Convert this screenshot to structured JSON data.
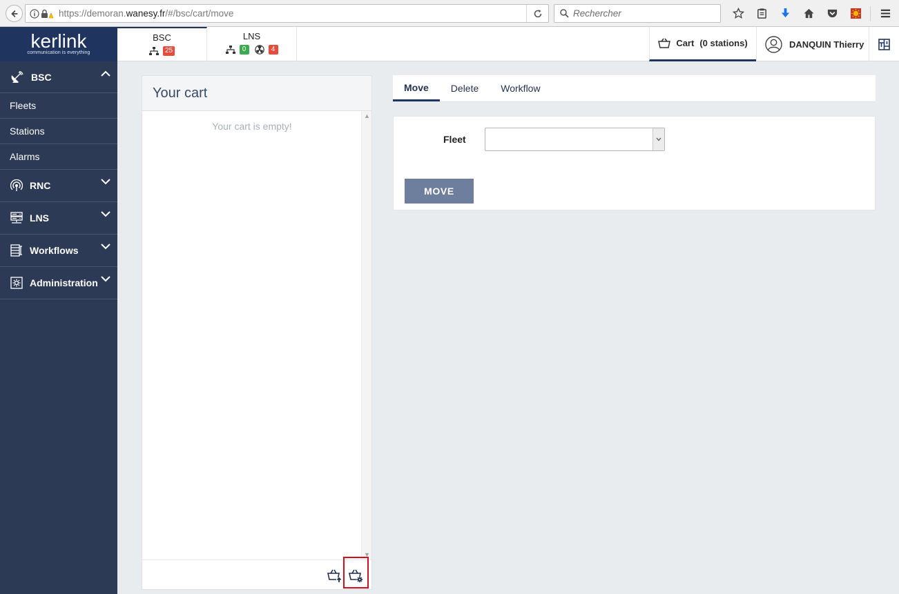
{
  "browser": {
    "url_prefix": "https://demoran.",
    "url_host": "wanesy.fr",
    "url_path": "/#/bsc/cart/move",
    "search_placeholder": "Rechercher"
  },
  "header": {
    "logo_text": "kerlink",
    "logo_tagline": "communication is everything",
    "modules": [
      {
        "title": "BSC",
        "stats": [
          {
            "icon": "network-icon",
            "count": "25",
            "color": "#e74c3c"
          }
        ]
      },
      {
        "title": "LNS",
        "stats": [
          {
            "icon": "network-icon",
            "count": "0",
            "color": "#3cab4f"
          },
          {
            "icon": "radiation-icon",
            "count": "4",
            "color": "#e74c3c"
          }
        ]
      }
    ],
    "cart_label": "Cart",
    "cart_count": "(0 stations)",
    "user_name": "DANQUIN Thierry"
  },
  "sidebar": {
    "groups": [
      {
        "label": "BSC",
        "icon": "satellite-dish-icon",
        "expanded": true,
        "items": [
          "Fleets",
          "Stations",
          "Alarms"
        ]
      },
      {
        "label": "RNC",
        "icon": "antenna-icon",
        "expanded": false
      },
      {
        "label": "LNS",
        "icon": "server-icon",
        "expanded": false
      },
      {
        "label": "Workflows",
        "icon": "workflow-icon",
        "expanded": false
      },
      {
        "label": "Administration",
        "icon": "admin-gear-icon",
        "expanded": false
      }
    ]
  },
  "cart_panel": {
    "title": "Your cart",
    "empty_text": "Your cart is empty!"
  },
  "tabs": [
    {
      "label": "Move",
      "active": true
    },
    {
      "label": "Delete",
      "active": false
    },
    {
      "label": "Workflow",
      "active": false
    }
  ],
  "form": {
    "fleet_label": "Fleet",
    "fleet_value": "",
    "move_button": "MOVE"
  },
  "colors": {
    "brand_navy": "#1f3560",
    "sidebar_bg": "#2c3a55",
    "button_bg": "#6e7e9d",
    "badge_red": "#e74c3c",
    "badge_green": "#3cab4f",
    "highlight_red": "#d0101e"
  }
}
